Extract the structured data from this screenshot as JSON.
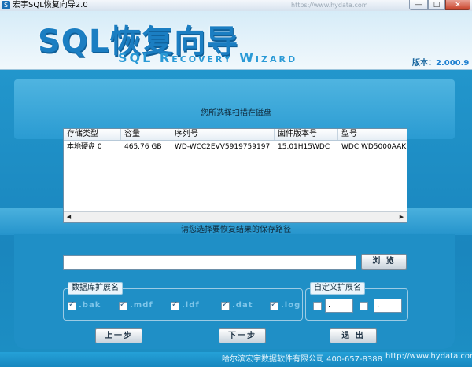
{
  "window": {
    "title": "宏宇SQL恢复向导2.0",
    "background_tab": "https://www.hydata.com",
    "minimize": "—",
    "maximize": "□",
    "close": "×"
  },
  "header": {
    "logo_cn": "SQL恢复向导",
    "logo_en": "SQL Recovery Wizard",
    "version_label": "版本：",
    "version_number": "2.000.9"
  },
  "disk_section": {
    "label": "您所选择扫描在磁盘",
    "columns": [
      "存储类型",
      "容量",
      "序列号",
      "固件版本号",
      "型号"
    ],
    "rows": [
      [
        "本地硬盘 0",
        "465.76 GB",
        "WD-WCC2EVV5919759197",
        "15.01H15WDC",
        "WDC WD5000AAK"
      ]
    ]
  },
  "path_section": {
    "label": "请您选择要恢复结果的保存路径",
    "path_value": "",
    "browse_button": "浏 览"
  },
  "extensions": {
    "legend": "数据库扩展名",
    "items": [
      {
        "label": ".bak",
        "checked": true
      },
      {
        "label": ".mdf",
        "checked": true
      },
      {
        "label": ".ldf",
        "checked": true
      },
      {
        "label": ".dat",
        "checked": true
      },
      {
        "label": ".log",
        "checked": true
      }
    ]
  },
  "custom_extensions": {
    "legend": "自定义扩展名",
    "field1": ".",
    "field2": "."
  },
  "navigation": {
    "prev": "上一步",
    "next": "下一步",
    "exit": "退 出"
  },
  "footer": {
    "company": "哈尔滨宏宇数据软件有限公司  400-657-8388",
    "website": "http://www.hydata.com"
  }
}
